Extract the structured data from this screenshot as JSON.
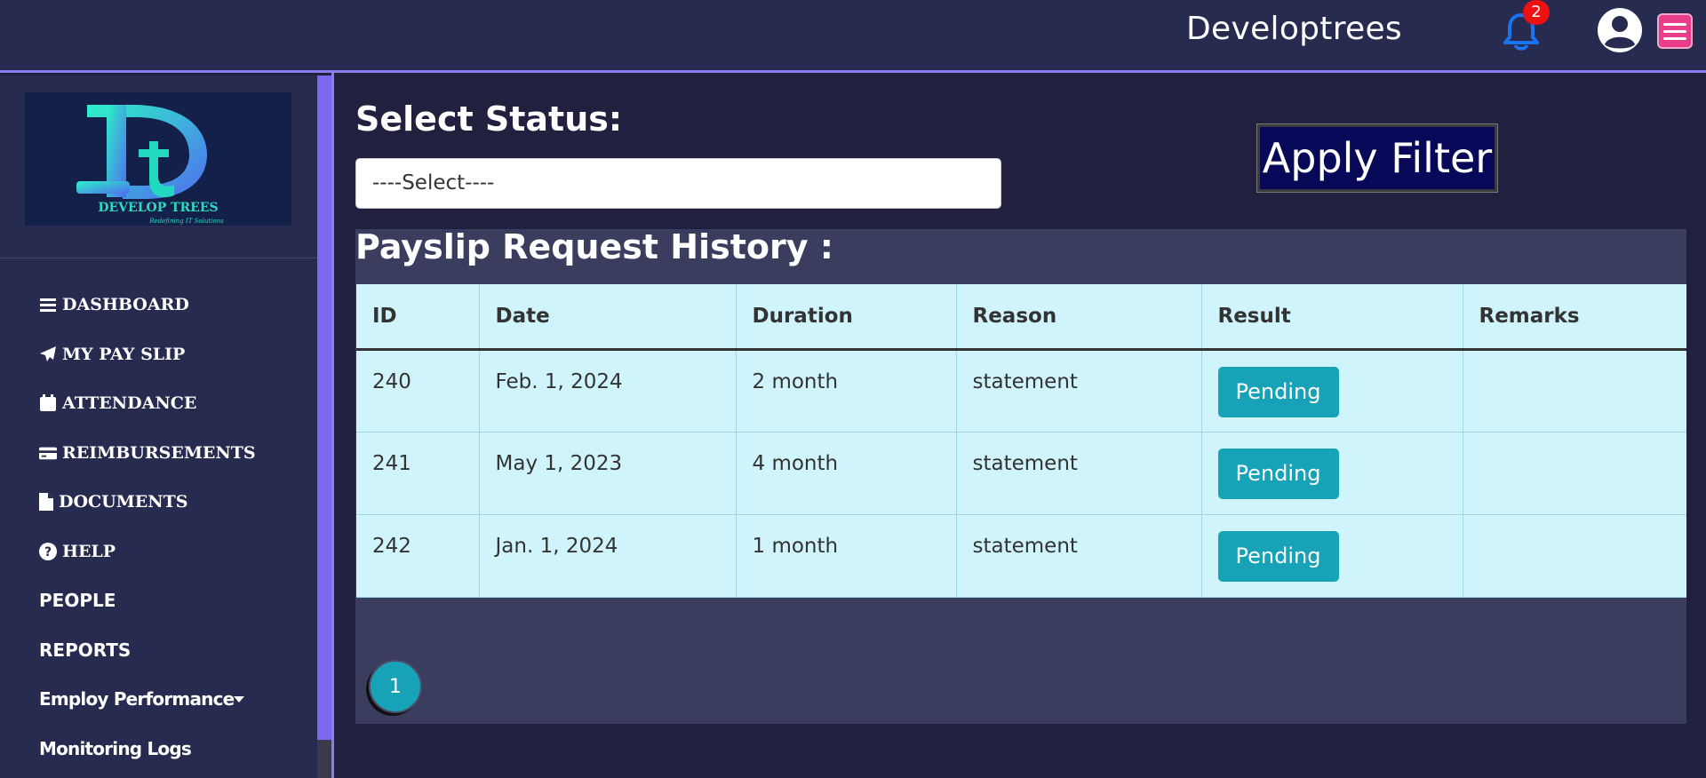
{
  "header": {
    "brand": "Developtrees",
    "notification_count": "2"
  },
  "sidebar": {
    "logo": {
      "text": "DEVELOP TREES",
      "tagline": "Redefining IT Solutions"
    },
    "items": [
      {
        "label": "DASHBOARD",
        "icon": "bars-icon"
      },
      {
        "label": "MY PAY SLIP",
        "icon": "paper-plane-icon"
      },
      {
        "label": "ATTENDANCE",
        "icon": "calendar-icon"
      },
      {
        "label": "REIMBURSEMENTS",
        "icon": "credit-card-icon"
      },
      {
        "label": "DOCUMENTS",
        "icon": "file-icon"
      },
      {
        "label": "HELP",
        "icon": "question-circle-icon"
      },
      {
        "label": "PEOPLE"
      },
      {
        "label": "REPORTS"
      },
      {
        "label": "Employ Performance"
      },
      {
        "label": "Monitoring Logs"
      }
    ]
  },
  "filter": {
    "label": "Select Status:",
    "selected": "----Select----",
    "apply_label": "Apply Filter"
  },
  "history": {
    "title": "Payslip Request History :",
    "columns": [
      "ID",
      "Date",
      "Duration",
      "Reason",
      "Result",
      "Remarks"
    ],
    "rows": [
      {
        "id": "240",
        "date": "Feb. 1, 2024",
        "duration": "2 month",
        "reason": "statement",
        "result": "Pending",
        "remarks": ""
      },
      {
        "id": "241",
        "date": "May 1, 2023",
        "duration": "4 month",
        "reason": "statement",
        "result": "Pending",
        "remarks": ""
      },
      {
        "id": "242",
        "date": "Jan. 1, 2024",
        "duration": "1 month",
        "reason": "statement",
        "result": "Pending",
        "remarks": ""
      }
    ]
  },
  "pagination": {
    "current_page": "1"
  },
  "colors": {
    "accent": "#8b7cf0",
    "pending": "#17a2b8",
    "table_bg": "#cff4fb",
    "menu_button": "#e83d8b"
  }
}
